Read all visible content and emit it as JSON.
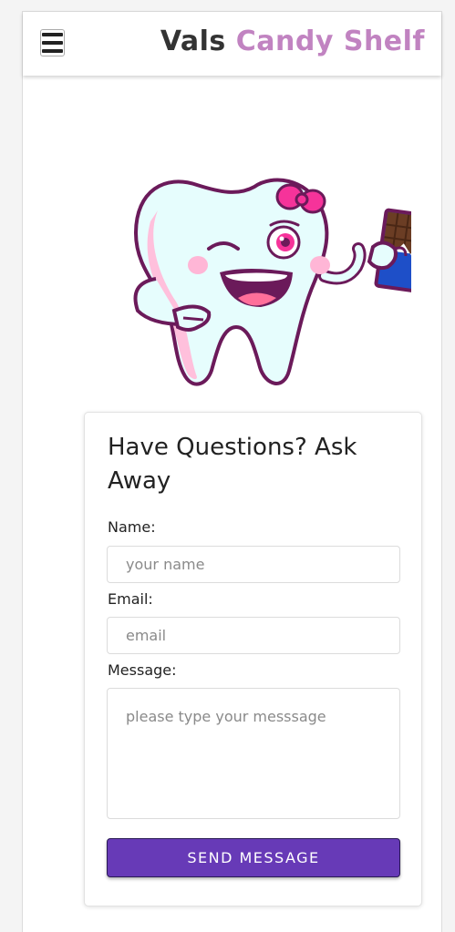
{
  "header": {
    "menu_icon": "hamburger-menu-icon",
    "brand_first": "Vals",
    "brand_second": "Candy Shelf"
  },
  "hero": {
    "image": "tooth-mascot-with-chocolate-bar"
  },
  "contact_form": {
    "title": "Have Questions? Ask Away",
    "name_label": "Name:",
    "name_placeholder": "your name",
    "email_label": "Email:",
    "email_placeholder": "email",
    "message_label": "Message:",
    "message_placeholder": "please type your messsage",
    "submit_label": "SEND MESSAGE"
  },
  "colors": {
    "brand_accent": "#c183c1",
    "button": "#673ab7",
    "mascot_pink": "#f6339a",
    "mascot_outline": "#6b1a5a"
  }
}
